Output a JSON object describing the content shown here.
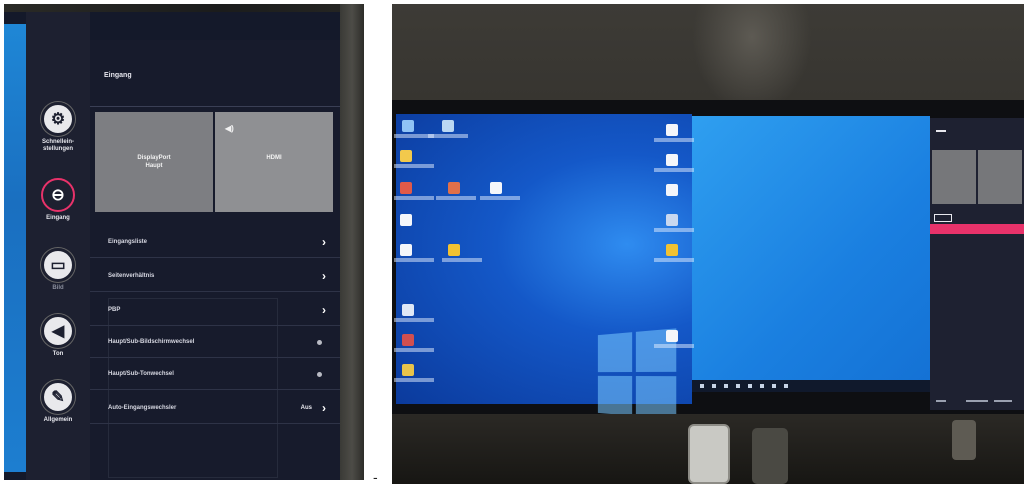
{
  "osd": {
    "side_menu": [
      {
        "label": "Schnellein-\nstellungen",
        "icon": "gear-icon"
      },
      {
        "label": "Eingang",
        "icon": "input-icon",
        "active": true
      },
      {
        "label": "Bild",
        "icon": "picture-icon"
      },
      {
        "label": "Ton",
        "icon": "speaker-icon"
      },
      {
        "label": "Allgemein",
        "icon": "general-icon"
      }
    ],
    "title": "Eingang",
    "inputs": [
      {
        "label": "DisplayPort\nHaupt",
        "selected": true
      },
      {
        "label": "HDMI",
        "icon": "speaker-icon"
      }
    ],
    "rows": [
      {
        "label": "Eingangsliste",
        "control": "arrow"
      },
      {
        "label": "Seitenverhältnis",
        "control": "arrow"
      },
      {
        "label": "PBP",
        "control": "arrow"
      },
      {
        "label": "Haupt/Sub-Bildschirmwechsel",
        "control": "dot"
      },
      {
        "label": "Haupt/Sub-Tonwechsel",
        "control": "dot"
      },
      {
        "label": "Auto-Eingangswechsler",
        "control": "value",
        "value": "Aus"
      }
    ]
  },
  "separator": "-",
  "colors": {
    "osd_accent": "#e8326a",
    "osd_background": "#171b2c",
    "windows_blue": "#1a7fe0"
  }
}
